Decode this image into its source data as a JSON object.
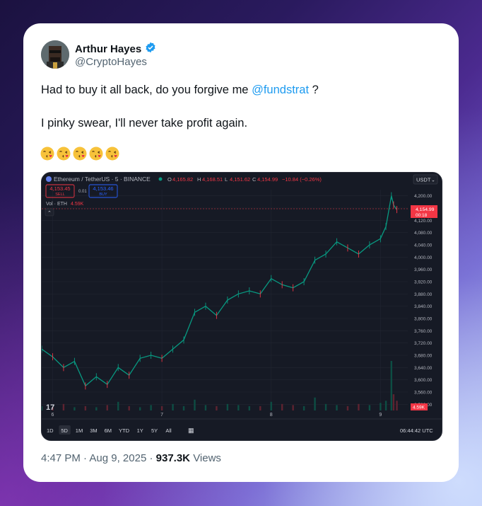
{
  "tweet": {
    "author_name": "Arthur Hayes",
    "handle": "@CryptoHayes",
    "text_before_mention": "Had to buy it all back, do you forgive me ",
    "mention": "@fundstrat",
    "text_after_mention": " ?",
    "line2": "I pinky swear, I'll never take profit again.",
    "emojis": [
      "kissing-face-icon",
      "kissing-face-icon",
      "kissing-face-icon",
      "kissing-face-icon",
      "kissing-face-icon"
    ],
    "time": "4:47 PM",
    "date": "Aug 9, 2025",
    "views_count": "937.3K",
    "views_label": "Views",
    "sep": "·",
    "verified_color": "#1d9bf0"
  },
  "chart_header": {
    "symbol": "Ethereum / TetherUS · 5 · BINANCE",
    "ohlc_o_label": "O",
    "ohlc_o": "4,165.82",
    "ohlc_h_label": "H",
    "ohlc_h": "4,168.51",
    "ohlc_l_label": "L",
    "ohlc_l": "4,151.62",
    "ohlc_c_label": "C",
    "ohlc_c": "4,154.99",
    "change": "−10.84 (−0.26%)",
    "sell_price": "4,153.45",
    "sell_label": "SELL",
    "spread": "0.01",
    "buy_price": "4,153.46",
    "buy_label": "BUY",
    "vol_label": "Vol · ETH",
    "vol_value": "4.59K",
    "currency": "USDT",
    "price_tag": "4,154.99",
    "price_tag_time": "00:18",
    "vol_tag": "4.59K",
    "clock": "06:44:42 UTC",
    "logo": "17"
  },
  "timeframes": [
    "1D",
    "5D",
    "1M",
    "3M",
    "6M",
    "YTD",
    "1Y",
    "5Y",
    "All"
  ],
  "timeframe_selected": "5D",
  "chart_data": {
    "type": "line",
    "title": "Ethereum / TetherUS · 5 · BINANCE",
    "x_ticks": [
      "6",
      "7",
      "8",
      "9"
    ],
    "y_ticks": [
      "4,200.00",
      "4,160.00",
      "4,120.00",
      "4,080.00",
      "4,040.00",
      "4,000.00",
      "3,960.00",
      "3,920.00",
      "3,880.00",
      "3,840.00",
      "3,800.00",
      "3,760.00",
      "3,720.00",
      "3,680.00",
      "3,640.00",
      "3,600.00",
      "3,560.00",
      "3,520.00"
    ],
    "ylim": [
      3500,
      4220
    ],
    "x": [
      5.9,
      6.0,
      6.1,
      6.2,
      6.3,
      6.4,
      6.5,
      6.6,
      6.7,
      6.8,
      6.9,
      7.0,
      7.1,
      7.2,
      7.3,
      7.4,
      7.5,
      7.6,
      7.7,
      7.8,
      7.9,
      8.0,
      8.1,
      8.2,
      8.3,
      8.4,
      8.5,
      8.6,
      8.7,
      8.8,
      8.9,
      9.0,
      9.05,
      9.1,
      9.12,
      9.15
    ],
    "series": [
      {
        "values": [
          3700,
          3675,
          3640,
          3660,
          3580,
          3610,
          3585,
          3640,
          3615,
          3670,
          3680,
          3670,
          3700,
          3730,
          3820,
          3840,
          3810,
          3860,
          3880,
          3890,
          3880,
          3930,
          3910,
          3900,
          3920,
          3990,
          4010,
          4050,
          4030,
          4010,
          4040,
          4060,
          4100,
          4200,
          4170,
          4155
        ]
      }
    ],
    "volume": [
      0.4,
      0.3,
      0.6,
      0.3,
      0.4,
      0.3,
      0.5,
      0.8,
      0.4,
      0.3,
      0.5,
      0.4,
      0.6,
      0.4,
      1.0,
      0.5,
      0.4,
      0.6,
      0.5,
      0.4,
      0.4,
      0.8,
      0.6,
      0.5,
      0.4,
      1.2,
      0.6,
      0.5,
      0.4,
      0.6,
      0.5,
      0.7,
      0.9,
      4.59,
      1.5,
      0.9
    ],
    "up_color": "#089981",
    "down_color": "#f23645",
    "grid": true
  }
}
